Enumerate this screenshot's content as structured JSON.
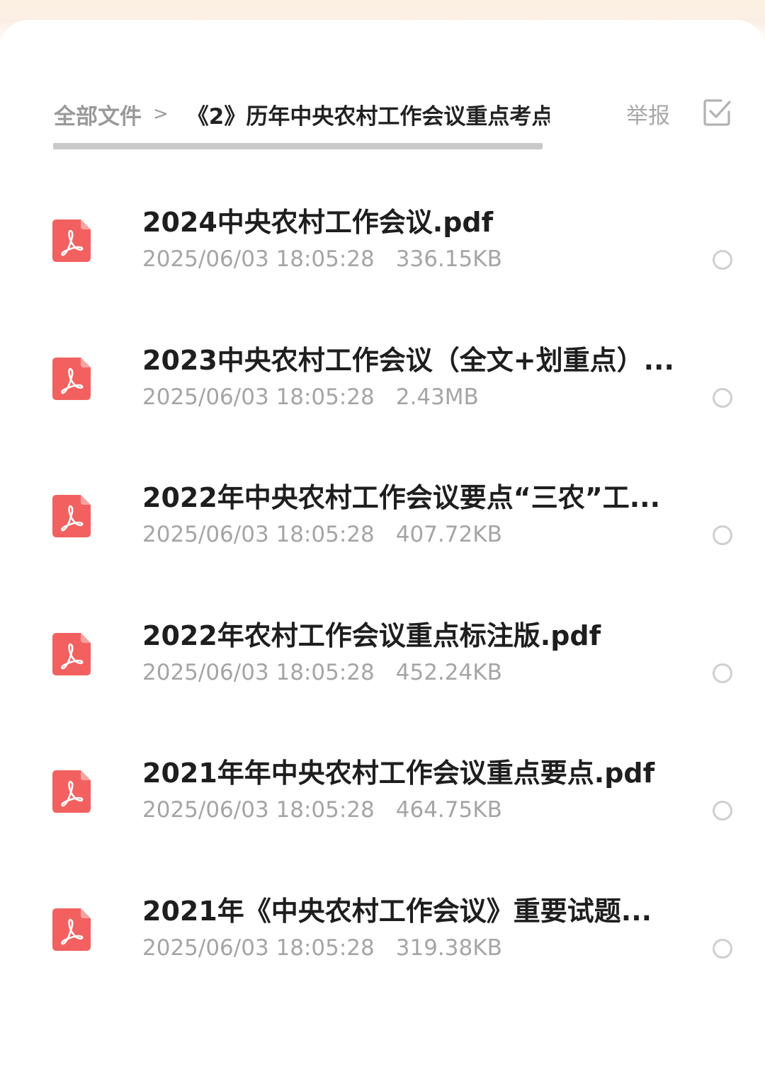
{
  "header": {
    "breadcrumb_root": "全部文件",
    "breadcrumb_separator": ">",
    "breadcrumb_current": "《2》历年中央农村工作会议重点考点",
    "report_label": "举报",
    "select_icon": "checkbox-select-icon"
  },
  "colors": {
    "pdf_icon": "#f2615f",
    "title_text": "#1e1e1e",
    "meta_text": "#a5a5a5"
  },
  "files": [
    {
      "name": "2024中央农村工作会议.pdf",
      "date": "2025/06/03 18:05:28",
      "size": "336.15KB",
      "icon": "pdf-icon"
    },
    {
      "name": "2023中央农村工作会议（全文+划重点）...",
      "date": "2025/06/03 18:05:28",
      "size": "2.43MB",
      "icon": "pdf-icon"
    },
    {
      "name": "2022年中央农村工作会议要点“三农”工...",
      "date": "2025/06/03 18:05:28",
      "size": "407.72KB",
      "icon": "pdf-icon"
    },
    {
      "name": "2022年农村工作会议重点标注版.pdf",
      "date": "2025/06/03 18:05:28",
      "size": "452.24KB",
      "icon": "pdf-icon"
    },
    {
      "name": "2021年年中央农村工作会议重点要点.pdf",
      "date": "2025/06/03 18:05:28",
      "size": "464.75KB",
      "icon": "pdf-icon"
    },
    {
      "name": "2021年《中央农村工作会议》重要试题...",
      "date": "2025/06/03 18:05:28",
      "size": "319.38KB",
      "icon": "pdf-icon"
    }
  ]
}
